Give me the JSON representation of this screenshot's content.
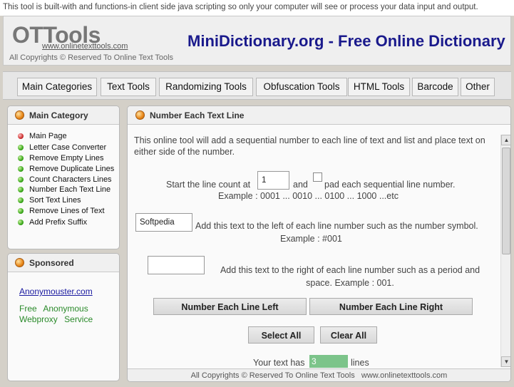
{
  "topbar": {
    "notice": "This tool is built-with and functions-in client side java scripting so only your computer will see or process your data input and output."
  },
  "header": {
    "logo": "OTTools",
    "logo_url": "www.onlinetexttools.com",
    "copyright": "All Copyrights © Reserved To Online Text Tools",
    "site_title": "MiniDictionary.org - Free Online Dictionary"
  },
  "nav": {
    "tabs": [
      "Main Categories",
      "Text Tools",
      "Randomizing Tools",
      "Obfuscation Tools",
      "HTML Tools",
      "Barcode",
      "Other"
    ]
  },
  "sidebar": {
    "main_category": {
      "title": "Main Category",
      "items": [
        "Main Page",
        "Letter Case Converter",
        "Remove Empty Lines",
        "Remove Duplicate Lines",
        "Count Characters Lines",
        "Number Each Text Line",
        "Sort Text Lines",
        "Remove Lines of Text",
        "Add Prefix Suffix"
      ]
    },
    "sponsored": {
      "title": "Sponsored",
      "link": "Anonymouster.com",
      "tagline": "Free Anonymous Webproxy Service"
    }
  },
  "main": {
    "title": "Number Each Text Line",
    "intro": "This online tool will add a sequential number to each line of text and list and place text on either side of the number.",
    "line_count": {
      "prefix_label": "Start the line count at",
      "value": "1",
      "and_label": "and",
      "pad_label": "pad each sequential line number.",
      "example": "Example : 0001 ... 0010 ... 0100 ... 1000 ...etc"
    },
    "left_text": {
      "value": "Softpedia",
      "label": "Add this text to the left of each line number such as the number symbol.",
      "example": "Example : #001"
    },
    "right_text": {
      "value": "",
      "label": "Add this text to the right of each line number such as a period and space. Example : 001."
    },
    "buttons": {
      "number_left": "Number Each Line Left",
      "number_right": "Number Each Line Right",
      "select_all": "Select All",
      "clear_all": "Clear All"
    },
    "line_counter": {
      "prefix": "Your text has",
      "value": "3",
      "suffix": "lines"
    },
    "footer": "All Copyrights © Reserved To Online Text Tools   www.onlinetexttools.com"
  }
}
